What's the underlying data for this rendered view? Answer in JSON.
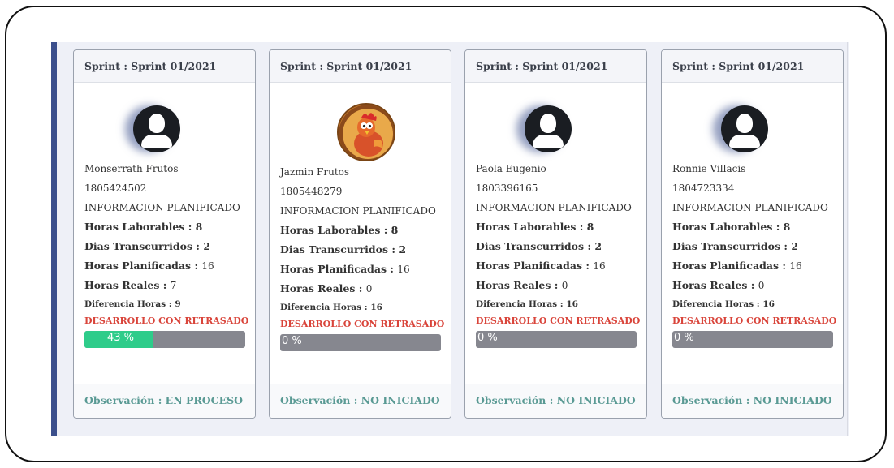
{
  "cards": [
    {
      "header": "Sprint : Sprint 01/2021",
      "avatar": "user-silhouette-icon",
      "name": "Monserrath Frutos",
      "id": "1805424502",
      "info": "INFORMACION PLANIFICADO",
      "horas_laborables_label": "Horas Laborables : 8",
      "dias_label": "Dias Transcurridos : 2",
      "horas_plan_label": "Horas Planificadas : ",
      "horas_plan_val": "16",
      "horas_reales_label": "Horas Reales : ",
      "horas_reales_val": "7",
      "diferencia": "Diferencia Horas : 9",
      "status": "DESARROLLO CON RETRASADO",
      "progress_percent": 43,
      "progress_text": "43 %",
      "observacion": "Observación : EN PROCESO"
    },
    {
      "header": "Sprint : Sprint 01/2021",
      "avatar": "hen-avatar-icon",
      "name": "Jazmin Frutos",
      "id": "1805448279",
      "info": "INFORMACION PLANIFICADO",
      "horas_laborables_label": "Horas Laborables : 8",
      "dias_label": "Dias Transcurridos : 2",
      "horas_plan_label": "Horas Planificadas : ",
      "horas_plan_val": "16",
      "horas_reales_label": "Horas Reales : ",
      "horas_reales_val": "0",
      "diferencia": "Diferencia Horas : 16",
      "status": "DESARROLLO CON RETRASADO",
      "progress_percent": 0,
      "progress_text": "0 %",
      "observacion": "Observación : NO INICIADO"
    },
    {
      "header": "Sprint : Sprint 01/2021",
      "avatar": "user-silhouette-icon",
      "name": "Paola Eugenio",
      "id": "1803396165",
      "info": "INFORMACION PLANIFICADO",
      "horas_laborables_label": "Horas Laborables : 8",
      "dias_label": "Dias Transcurridos : 2",
      "horas_plan_label": "Horas Planificadas : ",
      "horas_plan_val": "16",
      "horas_reales_label": "Horas Reales : ",
      "horas_reales_val": "0",
      "diferencia": "Diferencia Horas : 16",
      "status": "DESARROLLO CON RETRASADO",
      "progress_percent": 0,
      "progress_text": "0 %",
      "observacion": "Observación : NO INICIADO"
    },
    {
      "header": "Sprint : Sprint 01/2021",
      "avatar": "user-silhouette-icon",
      "name": "Ronnie Villacis",
      "id": "1804723334",
      "info": "INFORMACION PLANIFICADO",
      "horas_laborables_label": "Horas Laborables : 8",
      "dias_label": "Dias Transcurridos : 2",
      "horas_plan_label": "Horas Planificadas : ",
      "horas_plan_val": "16",
      "horas_reales_label": "Horas Reales : ",
      "horas_reales_val": "0",
      "diferencia": "Diferencia Horas : 16",
      "status": "DESARROLLO CON RETRASADO",
      "progress_percent": 0,
      "progress_text": "0 %",
      "observacion": "Observación : NO INICIADO"
    }
  ],
  "colors": {
    "status_red": "#d9443a",
    "progress_green": "#2ecc8a",
    "progress_track": "#86878f",
    "footer_teal": "#5a9a94",
    "panel_accent": "#3b4f8c"
  }
}
